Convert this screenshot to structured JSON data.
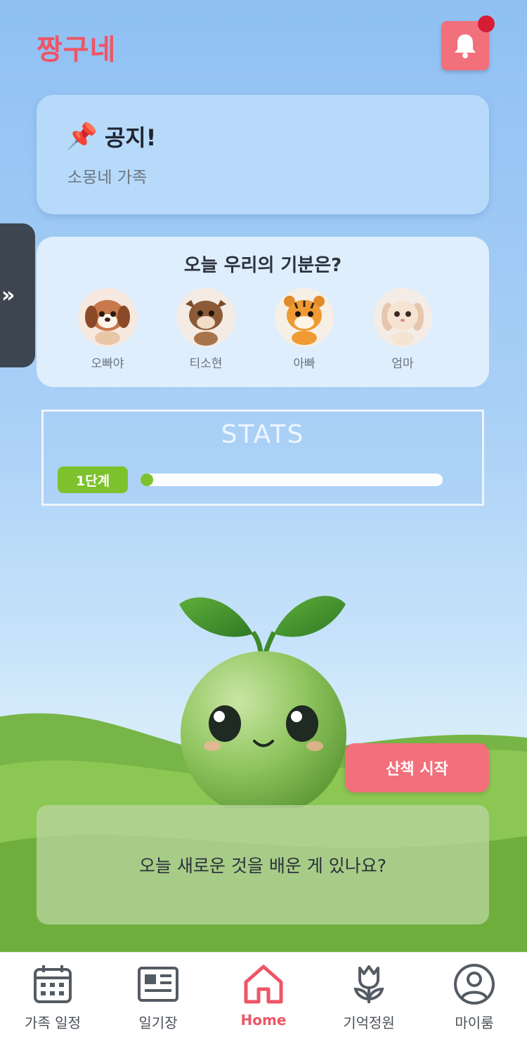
{
  "app": {
    "title": "짱구네"
  },
  "header": {
    "bell_icon": "bell-icon",
    "has_notification": true
  },
  "notice": {
    "icon": "📌",
    "title": "공지!",
    "body": "소몽네 가족"
  },
  "side_toggle": {
    "label": "»"
  },
  "mood": {
    "title": "오늘 우리의 기분은?",
    "members": [
      {
        "name": "오빠야",
        "avatar": "puppy-avatar"
      },
      {
        "name": "티소현",
        "avatar": "calf-avatar"
      },
      {
        "name": "아빠",
        "avatar": "tiger-avatar"
      },
      {
        "name": "엄마",
        "avatar": "bunny-avatar"
      }
    ]
  },
  "stats": {
    "title": "STATS",
    "level_label": "1단계",
    "progress": 0.02
  },
  "walk_button": {
    "label": "산책 시작"
  },
  "question": {
    "text": "오늘 새로운 것을 배운 게 있나요?"
  },
  "nav": {
    "items": [
      {
        "label": "가족 일정",
        "icon": "calendar-icon",
        "active": false
      },
      {
        "label": "일기장",
        "icon": "diary-icon",
        "active": false
      },
      {
        "label": "Home",
        "icon": "home-icon",
        "active": true
      },
      {
        "label": "기억정원",
        "icon": "tulip-icon",
        "active": false
      },
      {
        "label": "마이룸",
        "icon": "profile-icon",
        "active": false
      }
    ]
  },
  "colors": {
    "accent": "#ee5666",
    "button": "#f1707c",
    "level_green": "#7dc12d"
  }
}
